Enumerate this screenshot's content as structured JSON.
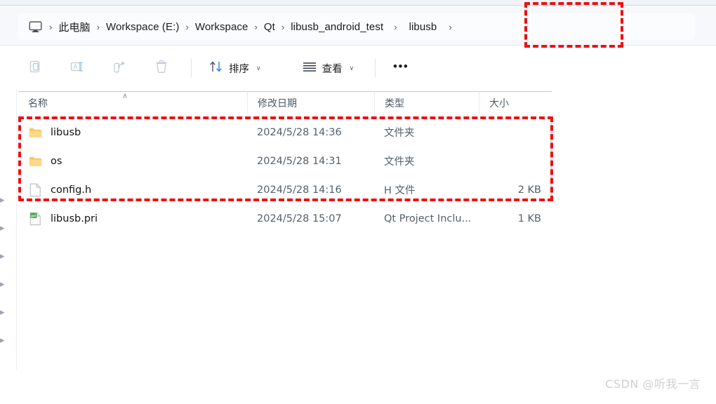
{
  "window": {
    "app": "File Explorer"
  },
  "addressbar": {
    "home_icon": "this-pc-icon",
    "separator": "›",
    "crumbs": [
      {
        "label": "此电脑",
        "cjk": true
      },
      {
        "label": "Workspace (E:)",
        "cjk": false
      },
      {
        "label": "Workspace",
        "cjk": false
      },
      {
        "label": "Qt",
        "cjk": false
      },
      {
        "label": "libusb_android_test",
        "cjk": false
      },
      {
        "label": "libusb",
        "cjk": false
      }
    ]
  },
  "toolbar": {
    "buttons": [
      {
        "name": "paste-button",
        "icon": "paste-icon",
        "label": "",
        "disabled": true,
        "caret": false
      },
      {
        "name": "rename-button",
        "icon": "rename-icon",
        "label": "",
        "disabled": true,
        "caret": false
      },
      {
        "name": "share-button",
        "icon": "share-icon",
        "label": "",
        "disabled": true,
        "caret": false
      },
      {
        "name": "delete-button",
        "icon": "trash-icon",
        "label": "",
        "disabled": true,
        "caret": false
      }
    ],
    "sort_label": "排序",
    "view_label": "查看",
    "caret_glyph": "∨",
    "more_label": "•••"
  },
  "columns": {
    "sort_indicator": "∧",
    "headers": [
      {
        "key": "name",
        "label": "名称"
      },
      {
        "key": "date",
        "label": "修改日期"
      },
      {
        "key": "type",
        "label": "类型"
      },
      {
        "key": "size",
        "label": "大小"
      }
    ]
  },
  "files": [
    {
      "name": "libusb",
      "icon": "folder-icon",
      "date": "2024/5/28 14:36",
      "type": "文件夹",
      "size": ""
    },
    {
      "name": "os",
      "icon": "folder-icon",
      "date": "2024/5/28 14:31",
      "type": "文件夹",
      "size": ""
    },
    {
      "name": "config.h",
      "icon": "file-generic-icon",
      "date": "2024/5/28 14:16",
      "type": "H 文件",
      "size": "2 KB"
    },
    {
      "name": "libusb.pri",
      "icon": "qt-pri-file-icon",
      "date": "2024/5/28 15:07",
      "type": "Qt Project Inclu...",
      "size": "1 KB"
    }
  ],
  "navpane": {
    "chevron_glyph": "▸",
    "chevron_count": 6
  },
  "annotations": {
    "color": "#ef1010",
    "boxes": [
      {
        "name": "annot-breadcrumb",
        "target": "libusb breadcrumb crumb"
      },
      {
        "name": "annot-files",
        "target": "libusb / os / config.h rows"
      }
    ]
  },
  "watermark": {
    "text": "CSDN @听我一言"
  }
}
